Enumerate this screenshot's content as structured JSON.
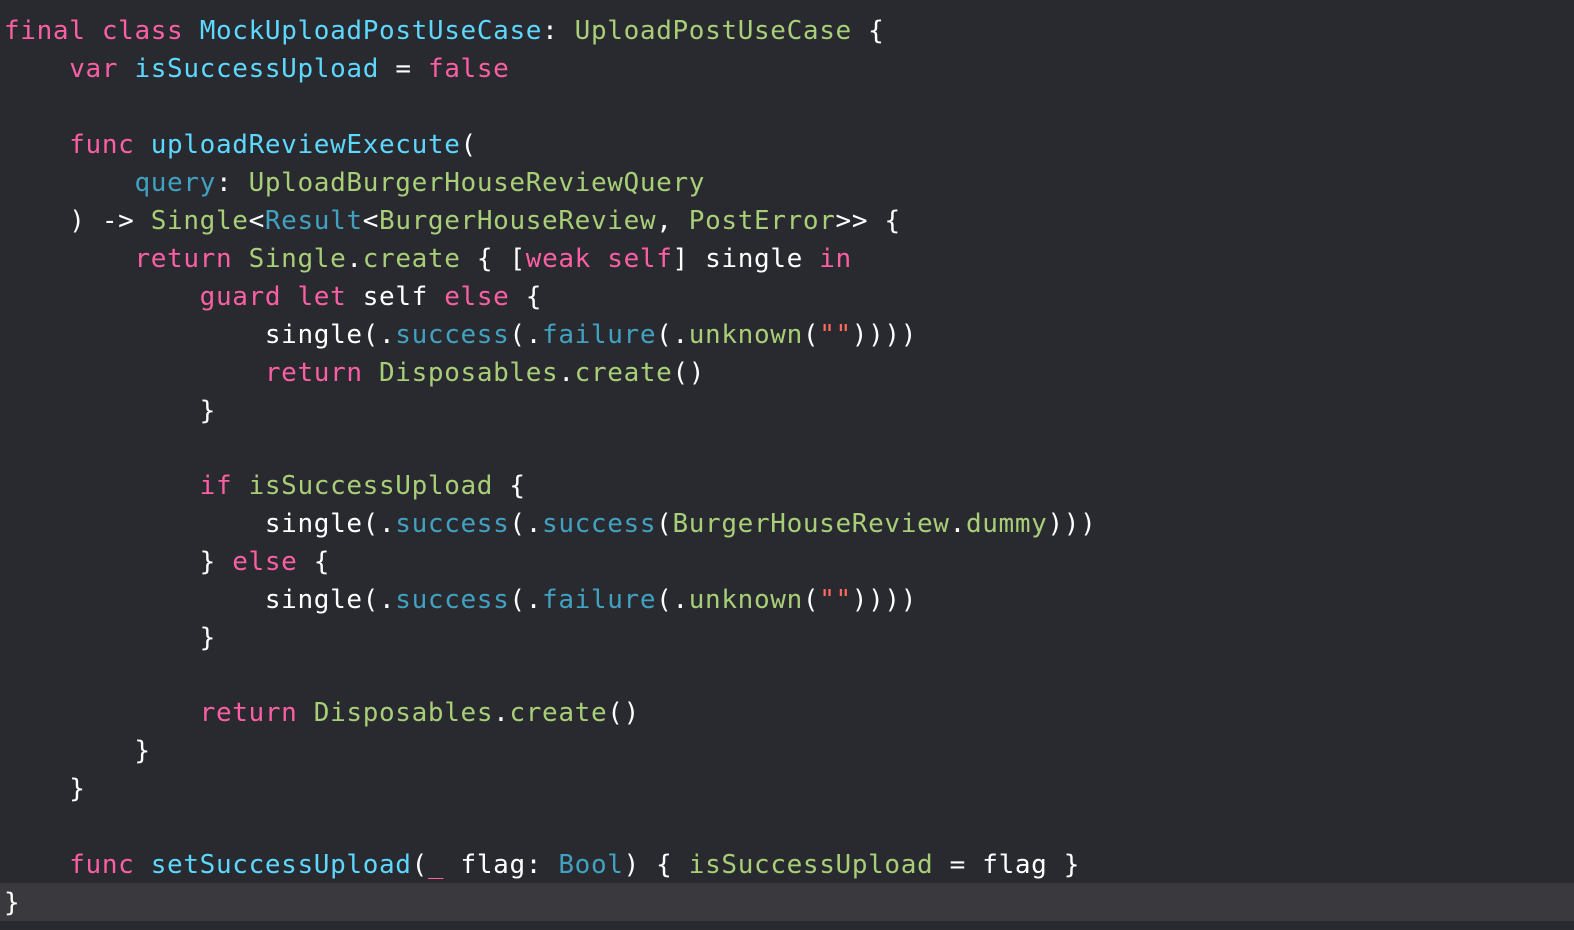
{
  "colors": {
    "background": "#292a30",
    "current_line": "#3a3a3e",
    "keyword": "#fc5fa3",
    "declaration": "#5dd8ff",
    "project_name": "#a8cf77",
    "member": "#41a1c0",
    "plain": "#ffffff",
    "string": "#fc6a5d"
  },
  "code": {
    "lines": [
      [
        {
          "t": "final",
          "c": "keyword"
        },
        {
          "t": " "
        },
        {
          "t": "class",
          "c": "keyword"
        },
        {
          "t": " "
        },
        {
          "t": "MockUploadPostUseCase",
          "c": "decl"
        },
        {
          "t": ": "
        },
        {
          "t": "UploadPostUseCase",
          "c": "green"
        },
        {
          "t": " {"
        }
      ],
      [
        {
          "t": "    "
        },
        {
          "t": "var",
          "c": "keyword"
        },
        {
          "t": " "
        },
        {
          "t": "isSuccessUpload",
          "c": "decl"
        },
        {
          "t": " = "
        },
        {
          "t": "false",
          "c": "keyword"
        }
      ],
      [],
      [
        {
          "t": "    "
        },
        {
          "t": "func",
          "c": "keyword"
        },
        {
          "t": " "
        },
        {
          "t": "uploadReviewExecute",
          "c": "decl"
        },
        {
          "t": "("
        }
      ],
      [
        {
          "t": "        "
        },
        {
          "t": "query",
          "c": "teal"
        },
        {
          "t": ": "
        },
        {
          "t": "UploadBurgerHouseReviewQuery",
          "c": "green"
        }
      ],
      [
        {
          "t": "    ) -> "
        },
        {
          "t": "Single",
          "c": "green"
        },
        {
          "t": "<"
        },
        {
          "t": "Result",
          "c": "teal"
        },
        {
          "t": "<"
        },
        {
          "t": "BurgerHouseReview",
          "c": "green"
        },
        {
          "t": ", "
        },
        {
          "t": "PostError",
          "c": "green"
        },
        {
          "t": ">> {"
        }
      ],
      [
        {
          "t": "        "
        },
        {
          "t": "return",
          "c": "keyword"
        },
        {
          "t": " "
        },
        {
          "t": "Single",
          "c": "green"
        },
        {
          "t": "."
        },
        {
          "t": "create",
          "c": "green"
        },
        {
          "t": " { ["
        },
        {
          "t": "weak",
          "c": "keyword"
        },
        {
          "t": " "
        },
        {
          "t": "self",
          "c": "keyword"
        },
        {
          "t": "] single "
        },
        {
          "t": "in",
          "c": "keyword"
        }
      ],
      [
        {
          "t": "            "
        },
        {
          "t": "guard",
          "c": "keyword"
        },
        {
          "t": " "
        },
        {
          "t": "let",
          "c": "keyword"
        },
        {
          "t": " self "
        },
        {
          "t": "else",
          "c": "keyword"
        },
        {
          "t": " {"
        }
      ],
      [
        {
          "t": "                single(."
        },
        {
          "t": "success",
          "c": "teal"
        },
        {
          "t": "(."
        },
        {
          "t": "failure",
          "c": "teal"
        },
        {
          "t": "(."
        },
        {
          "t": "unknown",
          "c": "green"
        },
        {
          "t": "("
        },
        {
          "t": "\"\"",
          "c": "string"
        },
        {
          "t": "))))"
        }
      ],
      [
        {
          "t": "                "
        },
        {
          "t": "return",
          "c": "keyword"
        },
        {
          "t": " "
        },
        {
          "t": "Disposables",
          "c": "green"
        },
        {
          "t": "."
        },
        {
          "t": "create",
          "c": "green"
        },
        {
          "t": "()"
        }
      ],
      [
        {
          "t": "            }"
        }
      ],
      [],
      [
        {
          "t": "            "
        },
        {
          "t": "if",
          "c": "keyword"
        },
        {
          "t": " "
        },
        {
          "t": "isSuccessUpload",
          "c": "green"
        },
        {
          "t": " {"
        }
      ],
      [
        {
          "t": "                single(."
        },
        {
          "t": "success",
          "c": "teal"
        },
        {
          "t": "(."
        },
        {
          "t": "success",
          "c": "teal"
        },
        {
          "t": "("
        },
        {
          "t": "BurgerHouseReview",
          "c": "green"
        },
        {
          "t": "."
        },
        {
          "t": "dummy",
          "c": "green"
        },
        {
          "t": ")))"
        }
      ],
      [
        {
          "t": "            } "
        },
        {
          "t": "else",
          "c": "keyword"
        },
        {
          "t": " {"
        }
      ],
      [
        {
          "t": "                single(."
        },
        {
          "t": "success",
          "c": "teal"
        },
        {
          "t": "(."
        },
        {
          "t": "failure",
          "c": "teal"
        },
        {
          "t": "(."
        },
        {
          "t": "unknown",
          "c": "green"
        },
        {
          "t": "("
        },
        {
          "t": "\"\"",
          "c": "string"
        },
        {
          "t": "))))"
        }
      ],
      [
        {
          "t": "            }"
        }
      ],
      [],
      [
        {
          "t": "            "
        },
        {
          "t": "return",
          "c": "keyword"
        },
        {
          "t": " "
        },
        {
          "t": "Disposables",
          "c": "green"
        },
        {
          "t": "."
        },
        {
          "t": "create",
          "c": "green"
        },
        {
          "t": "()"
        }
      ],
      [
        {
          "t": "        }"
        }
      ],
      [
        {
          "t": "    }"
        }
      ],
      [],
      [
        {
          "t": "    "
        },
        {
          "t": "func",
          "c": "keyword"
        },
        {
          "t": " "
        },
        {
          "t": "setSuccessUpload",
          "c": "decl"
        },
        {
          "t": "("
        },
        {
          "t": "_",
          "c": "keyword"
        },
        {
          "t": " flag: "
        },
        {
          "t": "Bool",
          "c": "teal"
        },
        {
          "t": ") { "
        },
        {
          "t": "isSuccessUpload",
          "c": "green"
        },
        {
          "t": " = flag }"
        }
      ],
      [
        {
          "t": "}"
        }
      ]
    ]
  }
}
